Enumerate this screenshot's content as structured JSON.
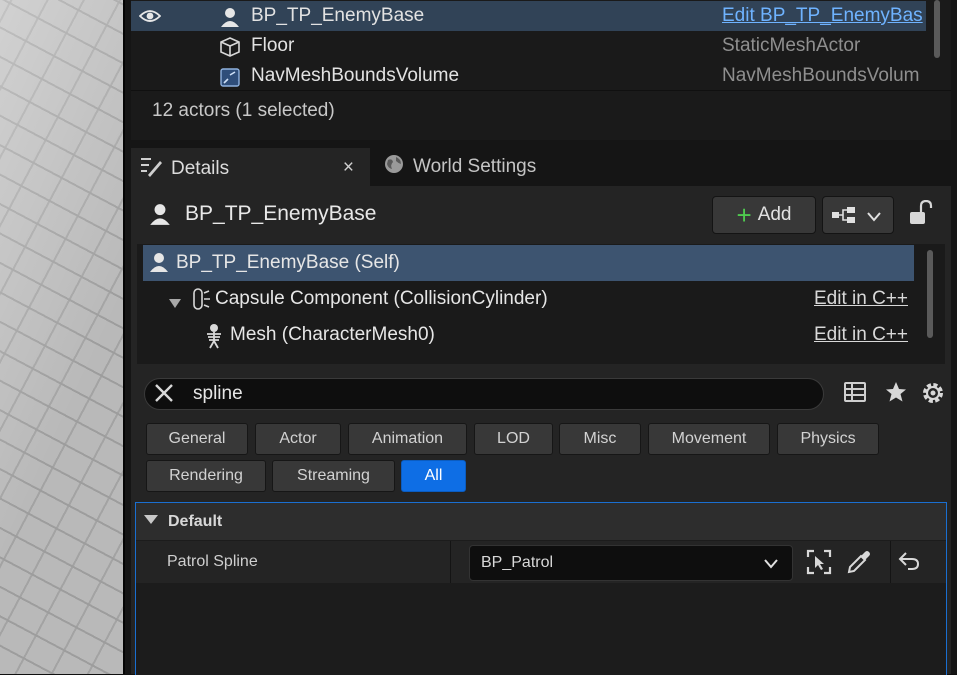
{
  "outliner": {
    "rows": [
      {
        "name": "BP_TP_EnemyBase",
        "type": "Edit BP_TP_EnemyBas"
      },
      {
        "name": "Floor",
        "type": "StaticMeshActor"
      },
      {
        "name": "NavMeshBoundsVolume",
        "type": "NavMeshBoundsVolum"
      }
    ],
    "status": "12 actors (1 selected)"
  },
  "tabs": {
    "details_label": "Details",
    "details_close": "×",
    "world_settings_label": "World Settings"
  },
  "details": {
    "actor_name": "BP_TP_EnemyBase",
    "add_button_label": "Add",
    "components": [
      {
        "name": "BP_TP_EnemyBase (Self)",
        "link": ""
      },
      {
        "name": "Capsule Component (CollisionCylinder)",
        "link": "Edit in C++"
      },
      {
        "name": "Mesh (CharacterMesh0)",
        "link": "Edit in C++"
      }
    ],
    "search": {
      "value": "spline"
    },
    "filters": [
      "General",
      "Actor",
      "Animation",
      "LOD",
      "Misc",
      "Movement",
      "Physics",
      "Rendering",
      "Streaming",
      "All"
    ],
    "active_filter": "All",
    "category": {
      "label": "Default",
      "properties": [
        {
          "label": "Patrol Spline",
          "value": "BP_Patrol"
        }
      ]
    }
  },
  "colors": {
    "accent": "#0e6ee5",
    "selection": "#314357",
    "link": "#6fb3ff",
    "add_plus": "#4fc94f"
  },
  "icons": [
    "eye-icon",
    "pawn-icon",
    "static-mesh-icon",
    "nav-volume-icon",
    "details-icon",
    "globe-icon",
    "skeleton-icon",
    "blueprint-icon",
    "lock-icon",
    "clear-icon",
    "table-icon",
    "star-icon",
    "gear-icon",
    "browse-icon",
    "eyedropper-icon",
    "reset-icon"
  ]
}
